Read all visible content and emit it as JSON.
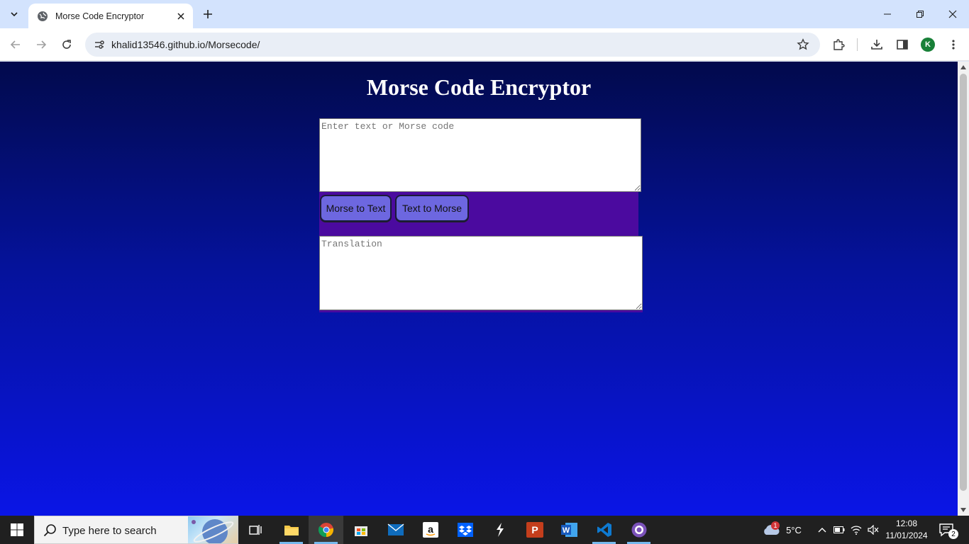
{
  "browser": {
    "tab_title": "Morse Code Encryptor",
    "url": "khalid13546.github.io/Morsecode/",
    "profile_initial": "K"
  },
  "page": {
    "title": "Morse Code Encryptor",
    "input_placeholder": "Enter text or Morse code",
    "output_placeholder": "Translation",
    "btn_morse_to_text": "Morse to Text",
    "btn_text_to_morse": "Text to Morse"
  },
  "taskbar": {
    "search_placeholder": "Type here to search",
    "weather_temp": "5°C",
    "weather_badge": "1",
    "time": "12:08",
    "date": "11/01/2024",
    "notification_count": "2"
  },
  "colors": {
    "bg_top": "#020a4c",
    "bg_bottom": "#0a15e6",
    "button_panel": "#4b0a9f",
    "button_fill": "#6d67e0"
  }
}
